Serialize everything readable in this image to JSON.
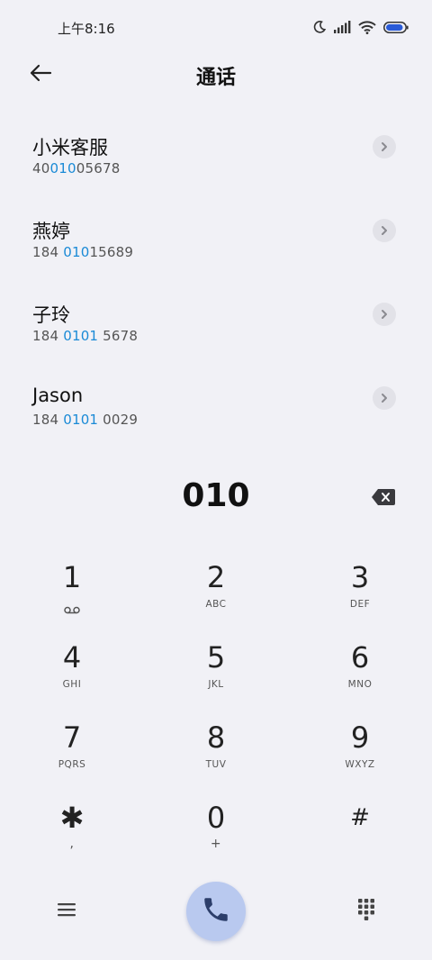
{
  "status_bar": {
    "time": "上午8:16",
    "icons": [
      "moon-icon",
      "signal-icon",
      "wifi-icon",
      "battery-icon"
    ]
  },
  "header": {
    "title": "通话",
    "back_icon": "arrow-left-icon"
  },
  "results": [
    {
      "name": "小米客服",
      "number_pre": "40",
      "number_match": "010",
      "number_post": "05678"
    },
    {
      "name": "燕婷",
      "number_pre": "184 ",
      "number_match": "010",
      "number_post": "15689"
    },
    {
      "name": "子玲",
      "number_pre": "184 ",
      "number_match": "0101",
      "number_post": " 5678"
    },
    {
      "name": "Jason",
      "number_pre": "184 ",
      "number_match": "0101",
      "number_post": " 0029"
    }
  ],
  "dial": {
    "input": "010"
  },
  "keypad": [
    {
      "digit": "1",
      "letters": "",
      "icon": "voicemail-icon"
    },
    {
      "digit": "2",
      "letters": "ABC"
    },
    {
      "digit": "3",
      "letters": "DEF"
    },
    {
      "digit": "4",
      "letters": "GHI"
    },
    {
      "digit": "5",
      "letters": "JKL"
    },
    {
      "digit": "6",
      "letters": "MNO"
    },
    {
      "digit": "7",
      "letters": "PQRS"
    },
    {
      "digit": "8",
      "letters": "TUV"
    },
    {
      "digit": "9",
      "letters": "WXYZ"
    },
    {
      "digit": "✱",
      "letters": ","
    },
    {
      "digit": "0",
      "letters": "+"
    },
    {
      "digit": "#",
      "letters": ""
    }
  ],
  "colors": {
    "background": "#f1f1f6",
    "match_highlight": "#1a8ad6",
    "call_button": "#b9c9ef",
    "call_icon": "#2c3e6a"
  }
}
